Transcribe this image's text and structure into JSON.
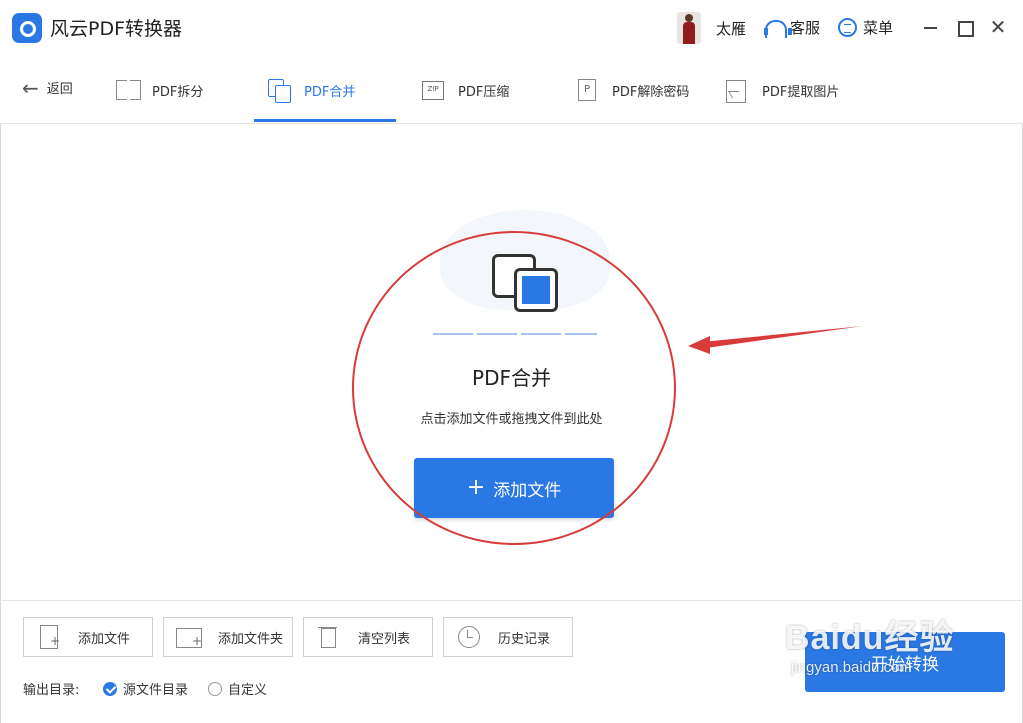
{
  "app": {
    "title": "风云PDF转换器"
  },
  "header": {
    "username": "太雁",
    "service_label": "客服",
    "menu_label": "菜单",
    "close_glyph": "✕"
  },
  "tabs": {
    "back_label": "返回",
    "items": [
      {
        "label": "PDF拆分",
        "icon": "split-icon"
      },
      {
        "label": "PDF合并",
        "icon": "merge-icon",
        "active": true
      },
      {
        "label": "PDF压缩",
        "icon": "zip-icon"
      },
      {
        "label": "PDF解除密码",
        "icon": "lock-icon"
      },
      {
        "label": "PDF提取图片",
        "icon": "image-icon"
      }
    ]
  },
  "dropzone": {
    "title": "PDF合并",
    "hint": "点击添加文件或拖拽文件到此处",
    "add_button": "添加文件",
    "plus_glyph": "+"
  },
  "toolbar": {
    "add_file": "添加文件",
    "add_folder": "添加文件夹",
    "clear_list": "清空列表",
    "history": "历史记录"
  },
  "output": {
    "label": "输出目录:",
    "options": [
      {
        "label": "源文件目录",
        "checked": true
      },
      {
        "label": "自定义",
        "checked": false
      }
    ]
  },
  "convert_button": "开始转换",
  "watermark": {
    "main": "Baidu经验",
    "sub": "jingyan.baidu.com"
  },
  "colors": {
    "accent": "#2a78e4",
    "annotation": "#d93a3a"
  }
}
